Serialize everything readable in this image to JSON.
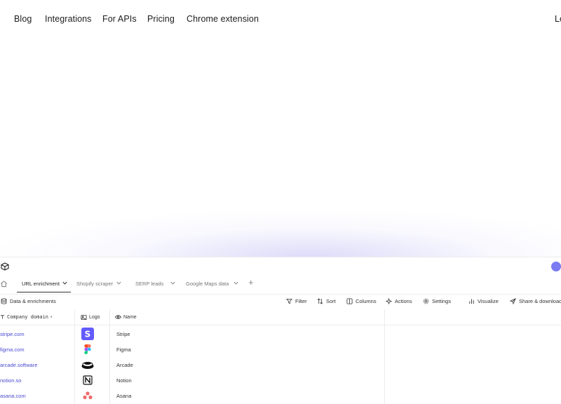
{
  "nav": {
    "links": [
      "Blog",
      "Integrations",
      "For APIs",
      "Pricing",
      "Chrome extension"
    ],
    "login_partial": "Lo"
  },
  "app": {
    "tabs": [
      {
        "label": "URL enrichment",
        "active": true
      },
      {
        "label": "Shopify scraper",
        "active": false
      },
      {
        "label": "SERP leads",
        "active": false
      },
      {
        "label": "Google Maps data",
        "active": false
      }
    ],
    "toolbar": {
      "section_label": "Data & enrichments",
      "filter": "Filter",
      "sort": "Sort",
      "columns": "Columns",
      "actions": "Actions",
      "settings": "Settings",
      "visualize": "Visualize",
      "share": "Share & download"
    },
    "columns": {
      "domain": "Company domain",
      "logo": "Logo",
      "name": "Name"
    },
    "rows": [
      {
        "domain": "stripe.com",
        "name": "Stripe",
        "logo_icon": "stripe-logo-icon"
      },
      {
        "domain": "figma.com",
        "name": "Figma",
        "logo_icon": "figma-logo-icon"
      },
      {
        "domain": "arcade.software",
        "name": "Arcade",
        "logo_icon": "arcade-logo-icon"
      },
      {
        "domain": "notion.so",
        "name": "Notion",
        "logo_icon": "notion-logo-icon"
      },
      {
        "domain": "asana.com",
        "name": "Asana",
        "logo_icon": "asana-logo-icon"
      }
    ]
  },
  "colors": {
    "accent": "#7b7bf2",
    "link": "#4a4ad0",
    "stripe": "#635bff",
    "asana": "#f06a6a"
  }
}
